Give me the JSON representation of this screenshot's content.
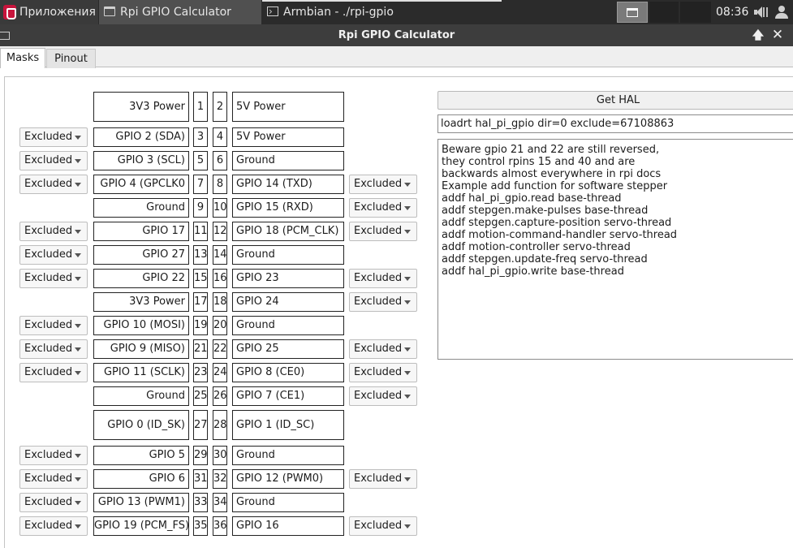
{
  "taskbar": {
    "apps_label": "Приложения",
    "window1_title": "Rpi GPIO Calculator",
    "window2_title": "Armbian - ./rpi-gpio",
    "clock": "08:36"
  },
  "window": {
    "title": "Rpi GPIO Calculator",
    "maximize_glyph": "🡅",
    "close_glyph": "✕"
  },
  "tabs": [
    {
      "label": "Masks",
      "active": true
    },
    {
      "label": "Pinout",
      "active": false
    }
  ],
  "combo_default": "Excluded",
  "pins": [
    {
      "pl": "1",
      "pr": "2",
      "left": "3V3 Power",
      "right": "5V Power",
      "cl": false,
      "cr": false
    },
    {
      "pl": "3",
      "pr": "4",
      "left": "GPIO 2 (SDA)",
      "right": "5V Power",
      "cl": true,
      "cr": false
    },
    {
      "pl": "5",
      "pr": "6",
      "left": "GPIO 3 (SCL)",
      "right": "Ground",
      "cl": true,
      "cr": false
    },
    {
      "pl": "7",
      "pr": "8",
      "left": "GPIO 4 (GPCLK0",
      "right": "GPIO 14 (TXD)",
      "cl": true,
      "cr": true
    },
    {
      "pl": "9",
      "pr": "10",
      "left": "Ground",
      "right": "GPIO 15 (RXD)",
      "cl": false,
      "cr": true
    },
    {
      "pl": "11",
      "pr": "12",
      "left": "GPIO 17",
      "right": "GPIO 18 (PCM_CLK)",
      "cl": true,
      "cr": true
    },
    {
      "pl": "13",
      "pr": "14",
      "left": "GPIO 27",
      "right": "Ground",
      "cl": true,
      "cr": false
    },
    {
      "pl": "15",
      "pr": "16",
      "left": "GPIO 22",
      "right": "GPIO 23",
      "cl": true,
      "cr": true
    },
    {
      "pl": "17",
      "pr": "18",
      "left": "3V3 Power",
      "right": "GPIO 24",
      "cl": false,
      "cr": true
    },
    {
      "pl": "19",
      "pr": "20",
      "left": "GPIO 10 (MOSI)",
      "right": "Ground",
      "cl": true,
      "cr": false
    },
    {
      "pl": "21",
      "pr": "22",
      "left": "GPIO 9 (MISO)",
      "right": "GPIO 25",
      "cl": true,
      "cr": true
    },
    {
      "pl": "23",
      "pr": "24",
      "left": "GPIO 11 (SCLK)",
      "right": "GPIO 8 (CE0)",
      "cl": true,
      "cr": true
    },
    {
      "pl": "25",
      "pr": "26",
      "left": "Ground",
      "right": "GPIO 7 (CE1)",
      "cl": false,
      "cr": true
    },
    {
      "pl": "27",
      "pr": "28",
      "left": "GPIO 0 (ID_SK)",
      "right": "GPIO 1 (ID_SC)",
      "cl": false,
      "cr": false
    },
    {
      "pl": "29",
      "pr": "30",
      "left": "GPIO 5",
      "right": "Ground",
      "cl": true,
      "cr": false
    },
    {
      "pl": "31",
      "pr": "32",
      "left": "GPIO 6",
      "right": "GPIO 12 (PWM0)",
      "cl": true,
      "cr": true
    },
    {
      "pl": "33",
      "pr": "34",
      "left": "GPIO 13 (PWM1)",
      "right": "Ground",
      "cl": true,
      "cr": false
    },
    {
      "pl": "35",
      "pr": "36",
      "left": "GPIO 19 (PCM_FS)",
      "right": "GPIO 16",
      "cl": true,
      "cr": true
    }
  ],
  "get_hal_label": "Get HAL",
  "hal_command": "loadrt hal_pi_gpio dir=0 exclude=67108863",
  "notes": [
    "Beware gpio 21 and 22 are still reversed,",
    "they control rpins 15 and 40 and are",
    "backwards almost everywhere in rpi docs",
    "Example add function for software stepper",
    "addf hal_pi_gpio.read base-thread",
    "addf stepgen.make-pulses base-thread",
    "addf stepgen.capture-position servo-thread",
    "addf motion-command-handler servo-thread",
    "addf motion-controller servo-thread",
    "addf stepgen.update-freq servo-thread",
    "addf hal_pi_gpio.write base-thread"
  ]
}
